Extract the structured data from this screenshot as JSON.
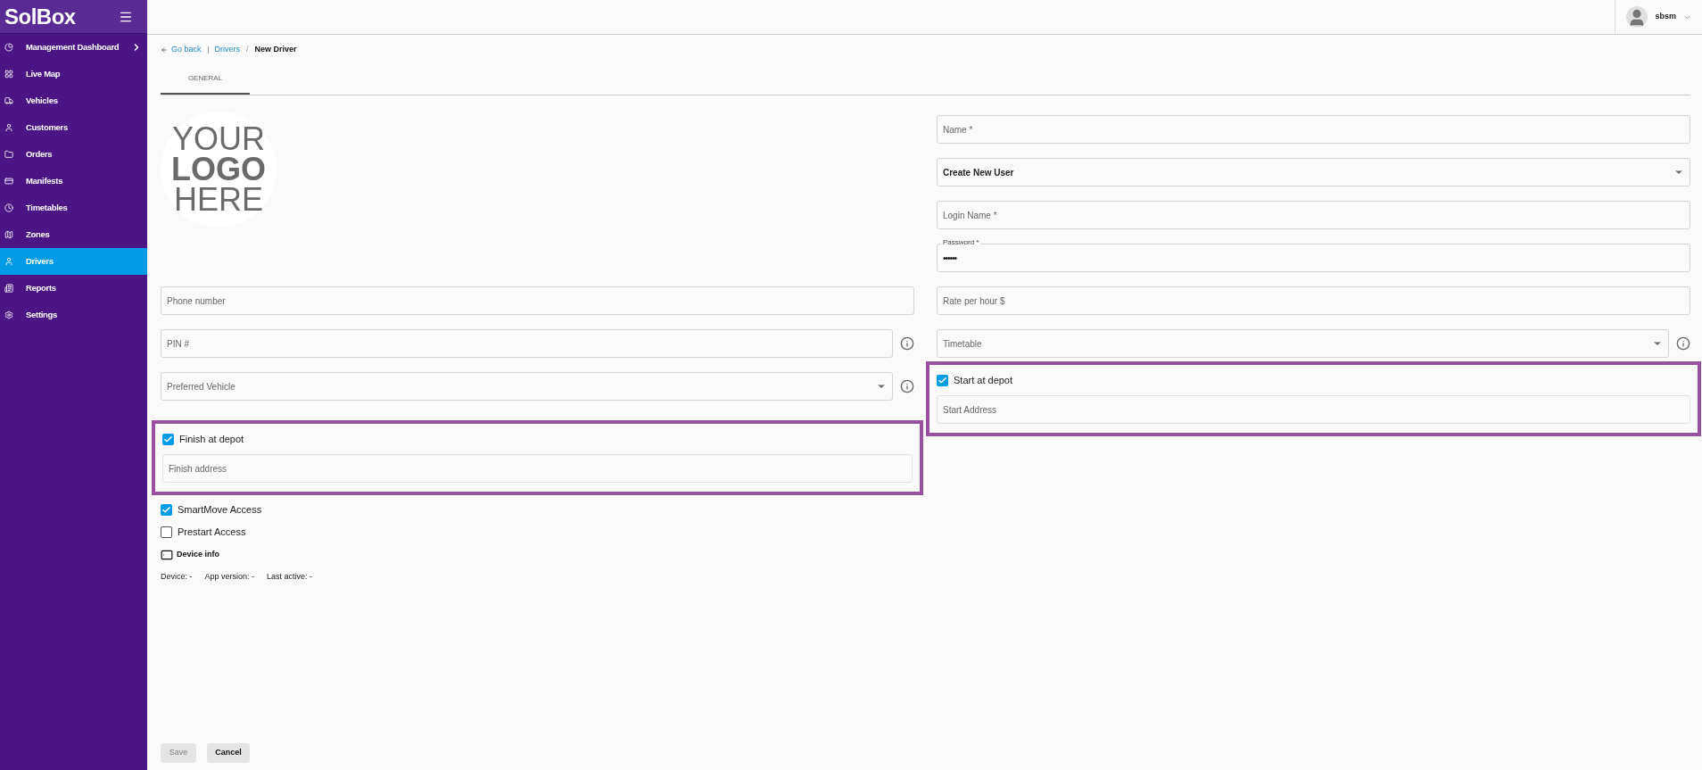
{
  "sidebar": {
    "brand": "SolBox",
    "items": [
      {
        "label": "Management Dashboard",
        "selected": false,
        "expandable": true
      },
      {
        "label": "Live Map",
        "selected": false,
        "expandable": false
      },
      {
        "label": "Vehicles",
        "selected": false,
        "expandable": false
      },
      {
        "label": "Customers",
        "selected": false,
        "expandable": false
      },
      {
        "label": "Orders",
        "selected": false,
        "expandable": false
      },
      {
        "label": "Manifests",
        "selected": false,
        "expandable": false
      },
      {
        "label": "Timetables",
        "selected": false,
        "expandable": false
      },
      {
        "label": "Zones",
        "selected": false,
        "expandable": false
      },
      {
        "label": "Drivers",
        "selected": true,
        "expandable": false
      },
      {
        "label": "Reports",
        "selected": false,
        "expandable": false
      },
      {
        "label": "Settings",
        "selected": false,
        "expandable": false
      }
    ]
  },
  "header": {
    "user": "sbsm"
  },
  "breadcrumb": {
    "back": "Go back",
    "link": "Drivers",
    "separator": "/",
    "current": "New Driver"
  },
  "tabs": [
    {
      "label": "GENERAL",
      "selected": true
    }
  ],
  "logo_placeholder": {
    "lines": [
      "YOUR",
      "LOGO",
      "HERE"
    ]
  },
  "account_fields": [
    {
      "kind": "text",
      "placeholder": "Name *"
    },
    {
      "kind": "select",
      "value": "Create New User"
    },
    {
      "kind": "text",
      "placeholder": "Login Name *"
    },
    {
      "kind": "password",
      "label": "Password *",
      "value": "••••••"
    }
  ],
  "rows": [
    {
      "left": {
        "kind": "text",
        "placeholder": "Phone number"
      },
      "right": {
        "kind": "text",
        "placeholder": "Rate per hour $"
      }
    },
    {
      "left": {
        "kind": "text",
        "placeholder": "PIN #",
        "info": true
      },
      "right": {
        "kind": "select",
        "placeholder": "Timetable",
        "info": true
      }
    }
  ],
  "preferred_vehicle": {
    "kind": "select",
    "placeholder": "Preferred Vehicle",
    "info": true
  },
  "start_depot": {
    "label": "Start at depot",
    "checked": true,
    "address_placeholder": "Start Address"
  },
  "finish_depot": {
    "label": "Finish at depot",
    "checked": true,
    "address_placeholder": "Finish address"
  },
  "access": [
    {
      "label": "SmartMove Access",
      "checked": true
    },
    {
      "label": "Prestart Access",
      "checked": false
    }
  ],
  "device_info": {
    "title": "Device info",
    "details": [
      "Device: -",
      "App version: -",
      "Last active: -"
    ]
  },
  "buttons": [
    {
      "label": "Save",
      "disabled": true
    },
    {
      "label": "Cancel",
      "disabled": false
    }
  ]
}
